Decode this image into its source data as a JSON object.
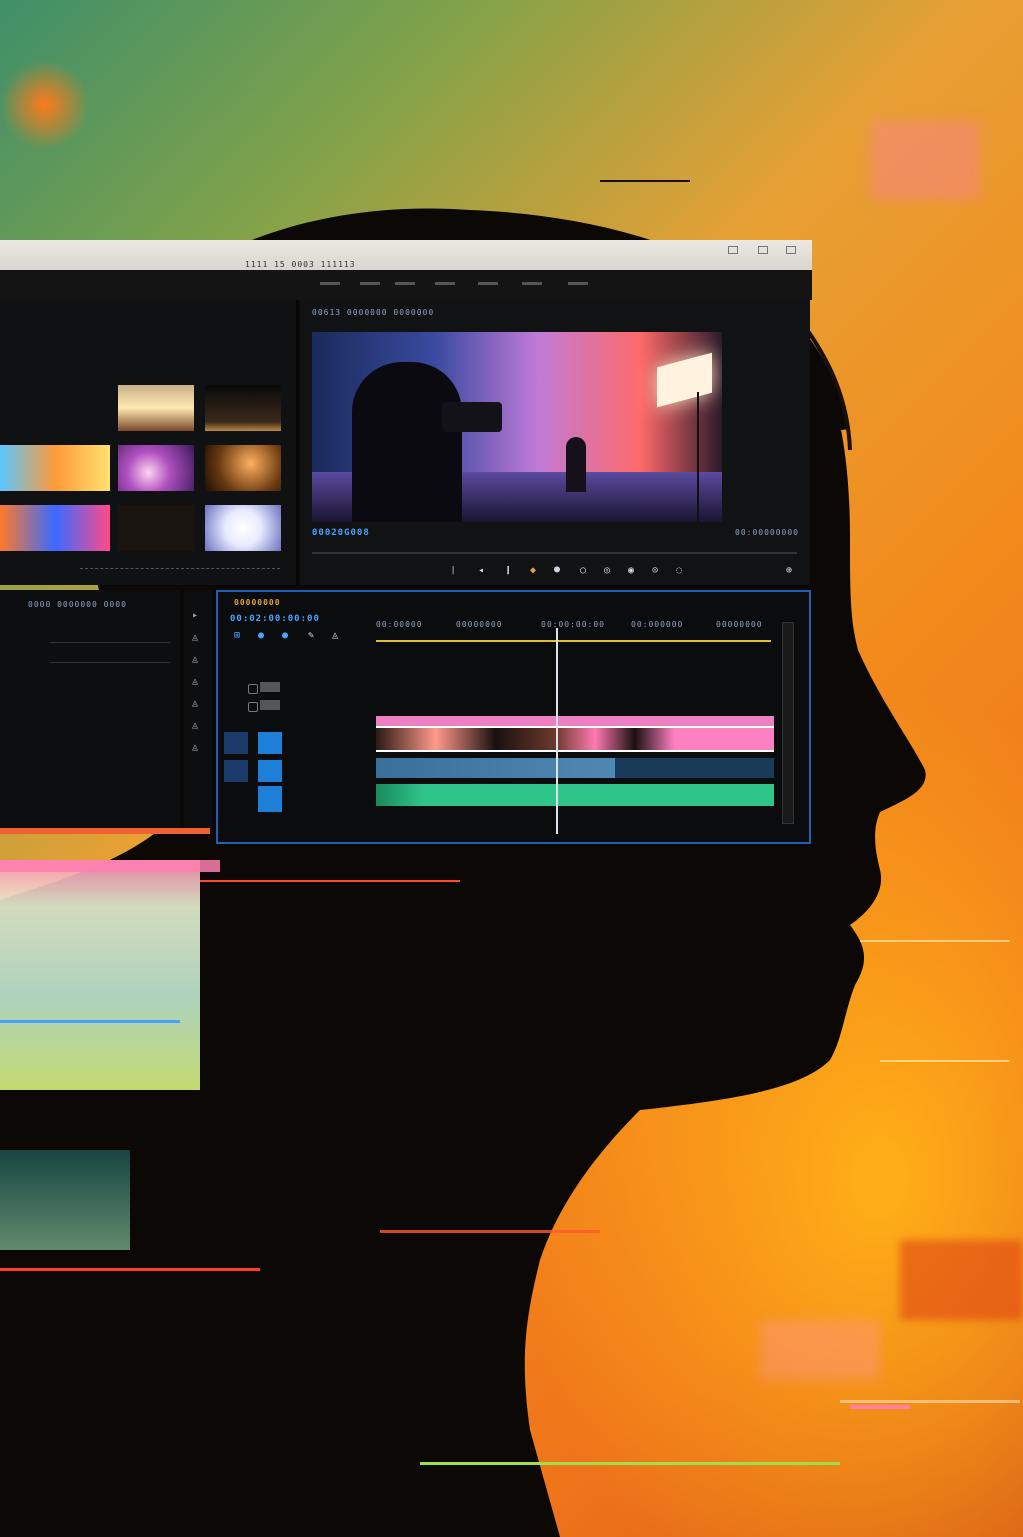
{
  "colors": {
    "background_warm": "#f28a1c",
    "background_cool": "#3f8f6a",
    "silhouette": "#0b0806",
    "ui_panel": "#111214",
    "accent_blue": "#2f8cff",
    "playhead": "#d9e2ea",
    "clip_pink": "#ee7fc2",
    "clip_audio_blue": "#3a6f9a",
    "clip_audio_green": "#2fc48a"
  },
  "editor": {
    "titlebar_text": "1111 15   0003 111113",
    "viewer_title": "00613 0000000 0000000",
    "viewer_timecode_left": "00020G008",
    "viewer_timecode_right": "00:00000000",
    "panel_header_text": "0000 0000000 0000",
    "timeline_title": "00000000",
    "timeline_timecode": "00:02:00:00:00",
    "ruler_labels": [
      "00:00000",
      "00000000",
      "00:00:00:00",
      "00:000000",
      "00000000"
    ]
  },
  "icons": {
    "play": "play-icon",
    "step_back": "step-back-icon",
    "step_forward": "step-forward-icon",
    "marker": "marker-icon",
    "settings": "settings-icon",
    "razor": "razor-tool-icon",
    "selection": "selection-tool-icon",
    "pen": "pen-tool-icon"
  }
}
